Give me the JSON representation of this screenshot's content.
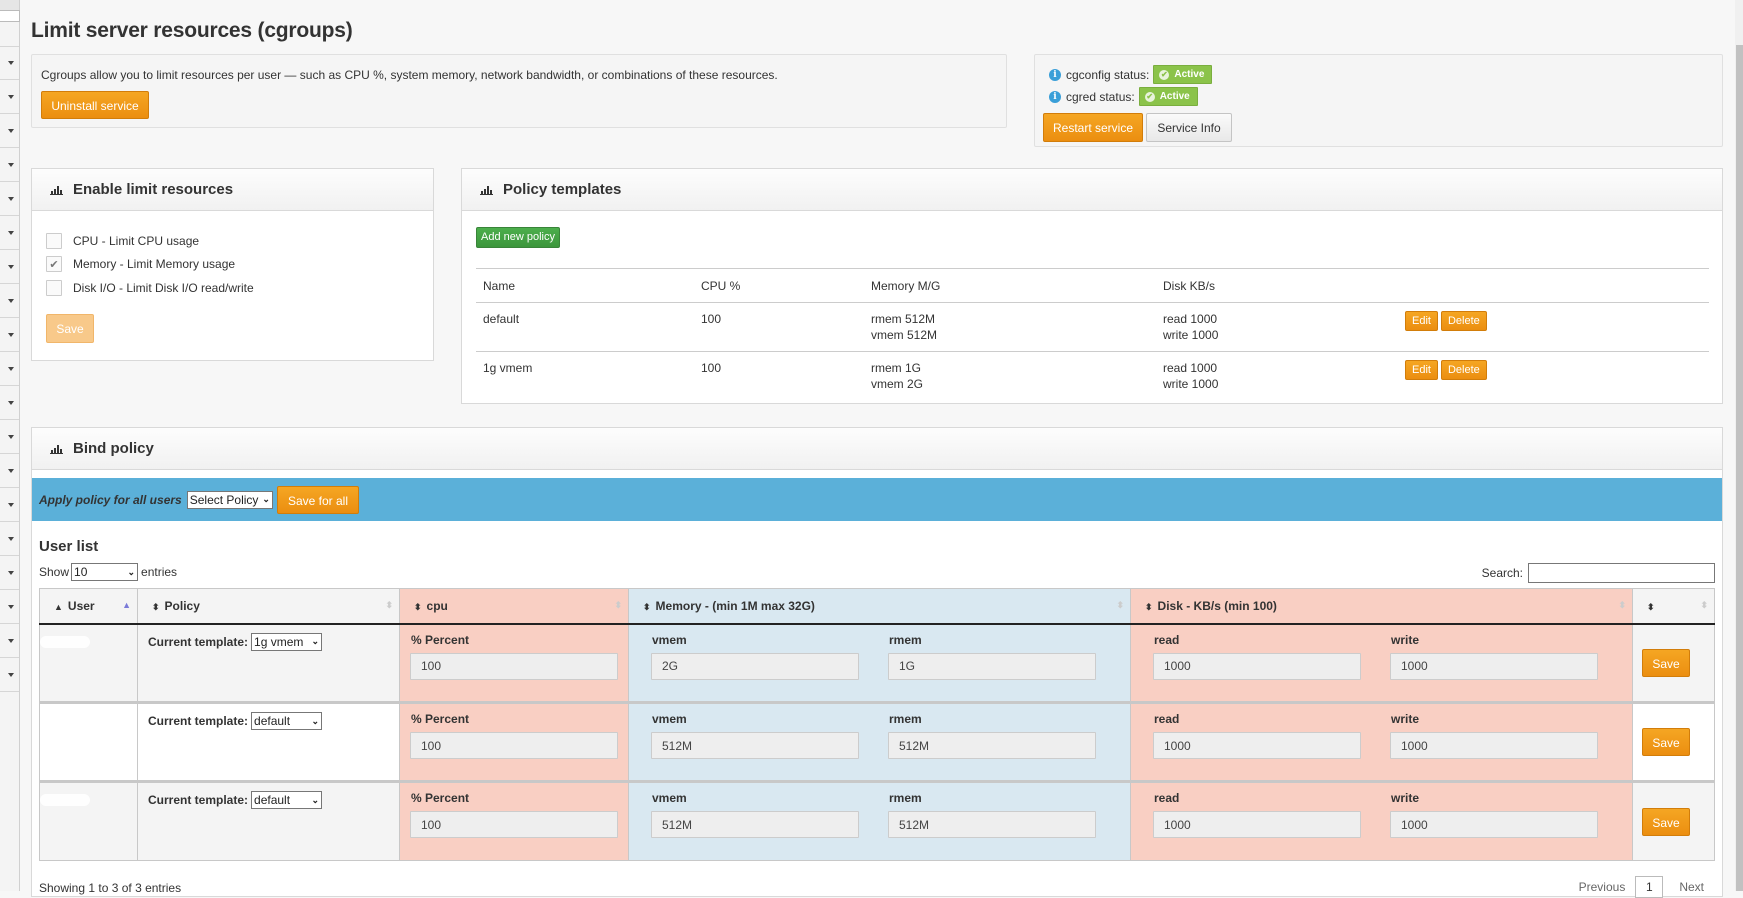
{
  "page": {
    "title": "Limit server resources (cgroups)"
  },
  "sidebar": {
    "item_count": 19
  },
  "intro": {
    "description": "Cgroups allow you to limit resources per user — such as CPU %, system memory, network bandwidth, or combinations of these resources.",
    "uninstall_label": "Uninstall service"
  },
  "status": {
    "cgconfig_label": "cgconfig status:",
    "cgconfig_value": "Active",
    "cgred_label": "cgred status:",
    "cgred_value": "Active",
    "restart_label": "Restart service",
    "info_label": "Service Info"
  },
  "enable": {
    "title": "Enable limit resources",
    "options": [
      {
        "label": "CPU - Limit CPU usage",
        "checked": false
      },
      {
        "label": "Memory - Limit Memory usage",
        "checked": true
      },
      {
        "label": "Disk I/O - Limit Disk I/O read/write",
        "checked": false
      }
    ],
    "save_label": "Save"
  },
  "templates": {
    "title": "Policy templates",
    "add_label": "Add new policy",
    "columns": [
      "Name",
      "CPU %",
      "Memory M/G",
      "Disk KB/s"
    ],
    "rows": [
      {
        "name": "default",
        "cpu": "100",
        "mem1": "rmem 512M",
        "mem2": "vmem 512M",
        "disk1": "read 1000",
        "disk2": "write 1000"
      },
      {
        "name": "1g vmem",
        "cpu": "100",
        "mem1": "rmem 1G",
        "mem2": "vmem 2G",
        "disk1": "read 1000",
        "disk2": "write 1000"
      }
    ],
    "edit_label": "Edit",
    "delete_label": "Delete"
  },
  "bind": {
    "title": "Bind policy",
    "apply_label": "Apply policy for all users",
    "select_policy": "Select Policy",
    "save_all_label": "Save for all",
    "user_list_title": "User list",
    "show_label": "Show",
    "show_value": "10",
    "entries_label": "entries",
    "search_label": "Search:",
    "search_value": "",
    "columns": {
      "user": "User",
      "policy": "Policy",
      "cpu": "cpu",
      "memory": "Memory - (min 1M max 32G)",
      "disk": "Disk - KB/s (min 100)",
      "action": ""
    },
    "labels": {
      "current_template": "Current template:",
      "percent": "% Percent",
      "vmem": "vmem",
      "rmem": "rmem",
      "read": "read",
      "write": "write",
      "save": "Save"
    },
    "users": [
      {
        "template": "1g vmem",
        "cpu": "100",
        "vmem": "2G",
        "rmem": "1G",
        "read": "1000",
        "write": "1000"
      },
      {
        "template": "default",
        "cpu": "100",
        "vmem": "512M",
        "rmem": "512M",
        "read": "1000",
        "write": "1000"
      },
      {
        "template": "default",
        "cpu": "100",
        "vmem": "512M",
        "rmem": "512M",
        "read": "1000",
        "write": "1000"
      }
    ],
    "showing": "Showing 1 to 3 of 3 entries",
    "prev_label": "Previous",
    "page": "1",
    "next_label": "Next"
  },
  "colors": {
    "accent_orange": "#eb8e10",
    "active_green": "#8bc34a",
    "apply_bar_blue": "#5bb0d9",
    "cpu_disk_pink": "#f9cfc3",
    "memory_blue": "#d9e8f1"
  }
}
